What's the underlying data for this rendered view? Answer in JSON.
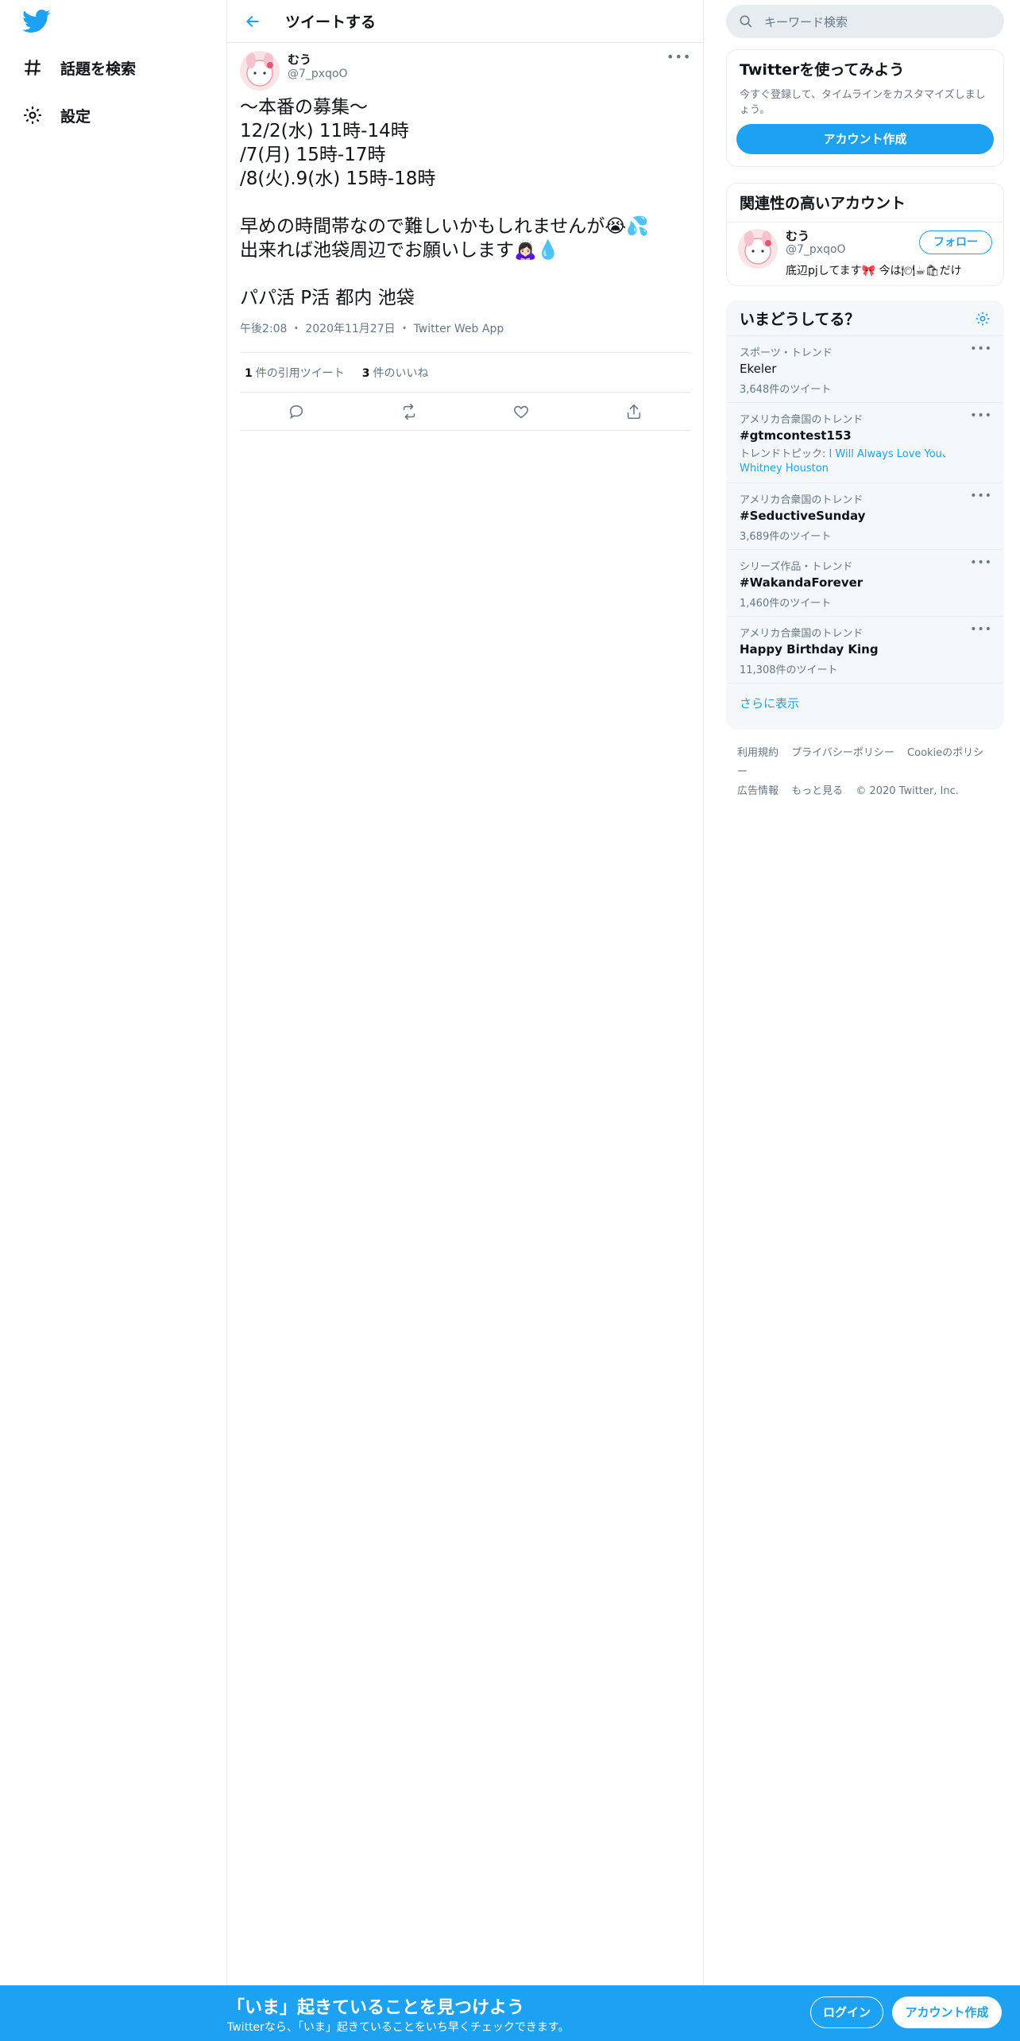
{
  "nav": {
    "items": [
      {
        "label": "話題を検索",
        "icon": "hashtag-icon"
      },
      {
        "label": "設定",
        "icon": "gear-icon"
      }
    ]
  },
  "header": {
    "title": "ツイートする"
  },
  "tweet": {
    "name": "むう",
    "handle": "@7_pxqoO",
    "body": "〜本番の募集〜\n12/2(水)  11時-14時\n/7(月)  15時-17時\n/8(火).9(水)  15時-18時\n\n早めの時間帯なので難しいかもしれませんが😭💦\n出来れば池袋周辺でお願いします🙇🏻‍♀️💧\n\nパパ活 P活 都内 池袋",
    "time": "午後2:08",
    "date": "2020年11月27日",
    "source": "Twitter Web App",
    "quote_count": "1",
    "quote_label": "件の引用ツイート",
    "like_count": "3",
    "like_label": "件のいいね"
  },
  "search": {
    "placeholder": "キーワード検索"
  },
  "signup": {
    "title": "Twitterを使ってみよう",
    "desc": "今すぐ登録して、タイムラインをカスタマイズしましょう。",
    "button": "アカウント作成"
  },
  "related": {
    "title": "関連性の高いアカウント",
    "name": "むう",
    "handle": "@7_pxqoO",
    "bio": "底辺pjしてます🎀 今は🍽☕🛍だけ",
    "follow": "フォロー"
  },
  "trends": {
    "title": "いまどうしてる？",
    "items": [
      {
        "context": "スポーツ・トレンド",
        "name": "Ekeler",
        "count": "3,648件のツイート",
        "hashtag": false
      },
      {
        "context": "アメリカ合衆国のトレンド",
        "name": "#gtmcontest153",
        "topic_label": "トレンドトピック: ",
        "topic": "I Will Always Love You、Whitney Houston",
        "hashtag": true
      },
      {
        "context": "アメリカ合衆国のトレンド",
        "name": "#SeductiveSunday",
        "count": "3,689件のツイート",
        "hashtag": true
      },
      {
        "context": "シリーズ作品・トレンド",
        "name": "#WakandaForever",
        "count": "1,460件のツイート",
        "hashtag": true
      },
      {
        "context": "アメリカ合衆国のトレンド",
        "name": "Happy Birthday King",
        "count": "11,308件のツイート",
        "hashtag": false
      }
    ],
    "more": "さらに表示"
  },
  "footer": {
    "links": [
      "利用規約",
      "プライバシーポリシー",
      "Cookieのポリシー",
      "広告情報",
      "もっと見る"
    ],
    "copyright": "© 2020 Twitter, Inc."
  },
  "bottom": {
    "headline": "「いま」起きていることを見つけよう",
    "sub": "Twitterなら、「いま」起きていることをいち早くチェックできます。",
    "login": "ログイン",
    "signup": "アカウント作成"
  },
  "colors": {
    "accent": "#1da1f2",
    "muted": "#657786",
    "border": "#e6ecf0"
  }
}
